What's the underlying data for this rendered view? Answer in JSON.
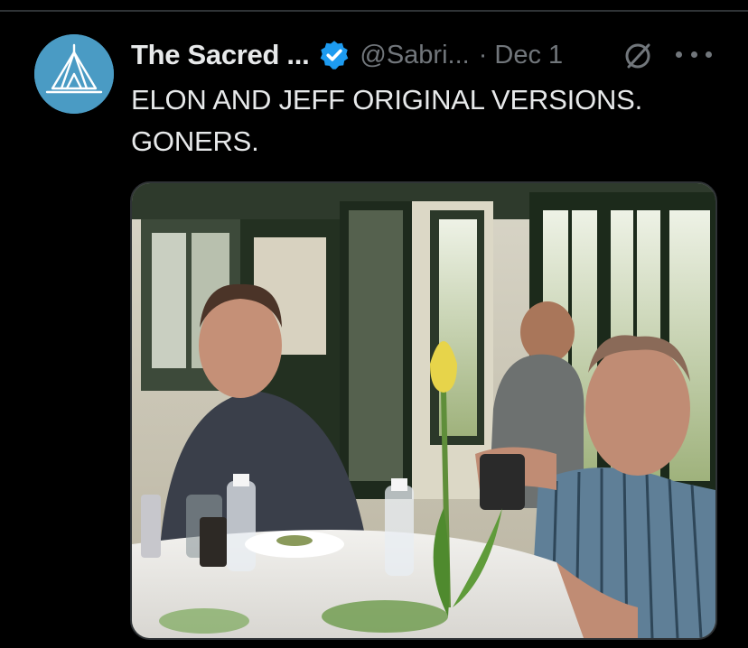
{
  "tweet": {
    "display_name": "The Sacred ...",
    "handle": "@Sabri...",
    "separator": "·",
    "date": "Dec 1",
    "text_lines": [
      "ELON AND JEFF ORIGINAL VERSIONS.",
      "GONERS."
    ]
  },
  "icons": {
    "avatar": "tent-logo-icon",
    "verified": "verified-badge-icon",
    "grok": "grok-icon",
    "more": "more-options-icon"
  },
  "colors": {
    "background": "#000000",
    "primary_text": "#e7e9ea",
    "secondary_text": "#71767b",
    "verified_blue": "#1d9bf0",
    "avatar_bg": "#4a9bc4",
    "divider": "#2f3336"
  }
}
